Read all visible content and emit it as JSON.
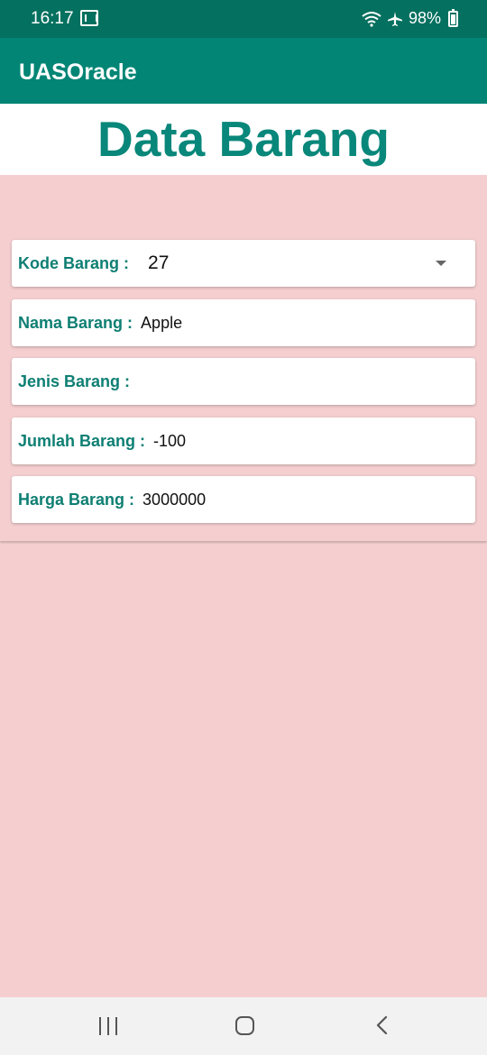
{
  "status_bar": {
    "time": "16:17",
    "battery": "98%",
    "icons": [
      "gmail-icon",
      "wifi-icon",
      "airplane-mode-icon",
      "battery-charging-icon"
    ]
  },
  "app_bar": {
    "title": "UASOracle"
  },
  "page_title": "Data Barang",
  "fields": {
    "kode": {
      "label": "Kode Barang :",
      "value": "27"
    },
    "nama": {
      "label": "Nama Barang :",
      "value": "Apple"
    },
    "jenis": {
      "label": "Jenis Barang :",
      "value": ""
    },
    "jumlah": {
      "label": "Jumlah Barang :",
      "value": "-100"
    },
    "harga": {
      "label": "Harga Barang :",
      "value": "3000000"
    }
  },
  "nav_bar": {
    "icons": [
      "recents-icon",
      "home-icon",
      "back-icon"
    ]
  },
  "colors": {
    "status_bar": "#04705f",
    "app_bar": "#028575",
    "accent": "#08877a",
    "background": "#f5cfd0"
  }
}
